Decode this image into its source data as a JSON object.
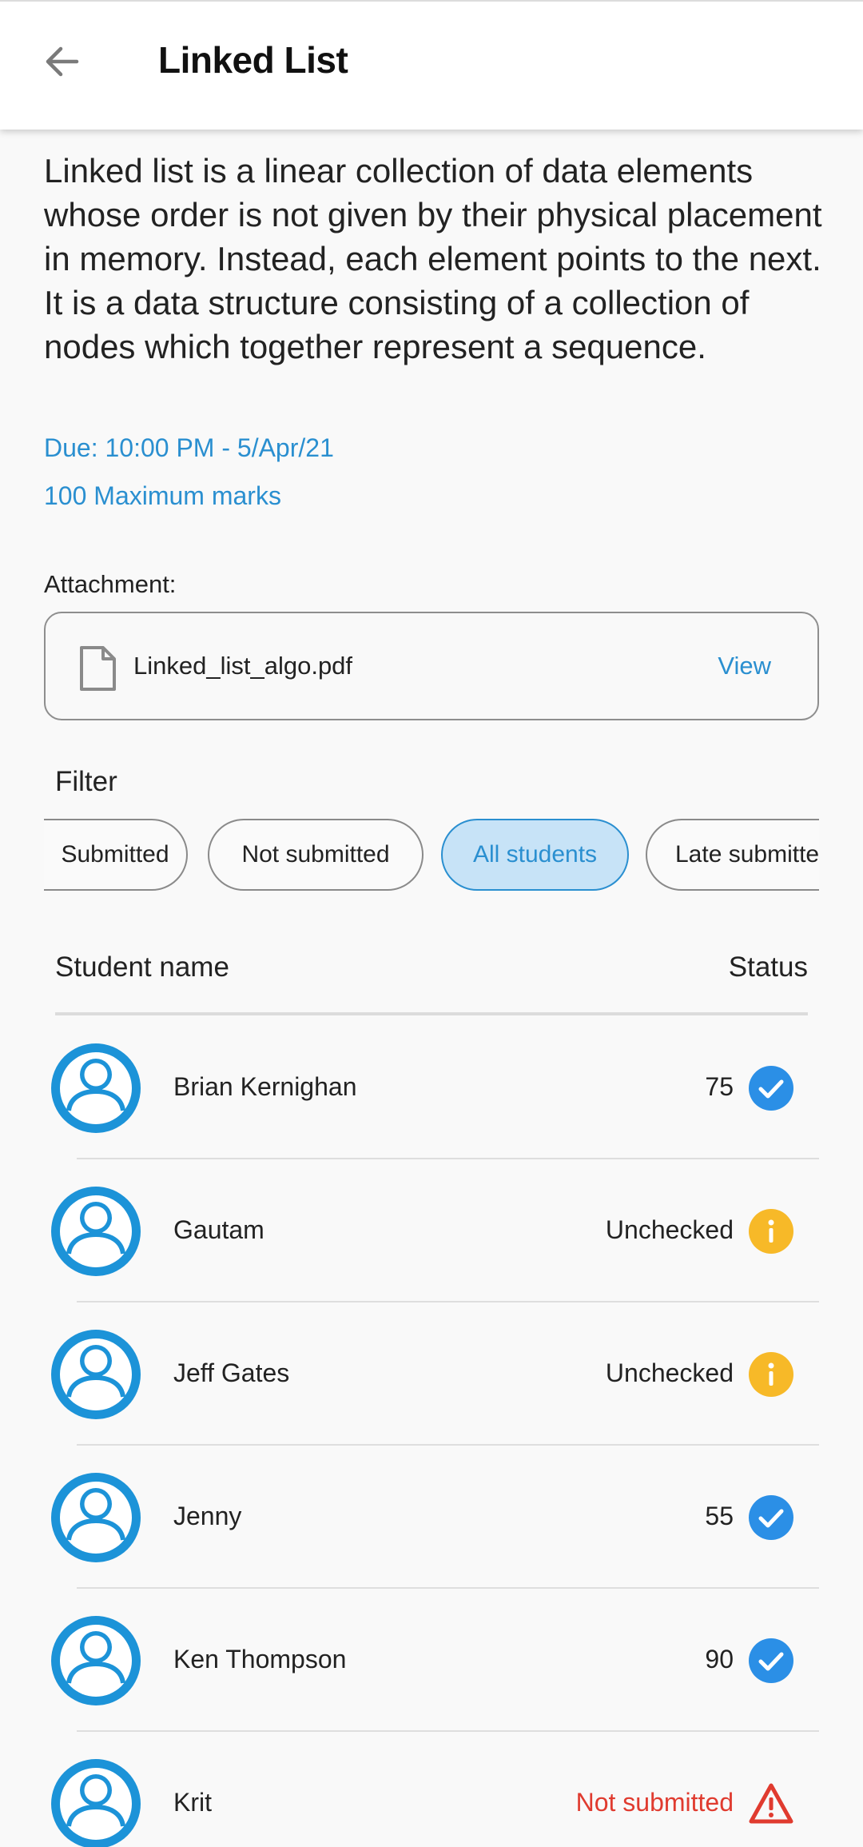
{
  "header": {
    "title": "Linked List",
    "back_icon": "arrow-left-icon"
  },
  "assignment": {
    "description": "Linked list is a linear collection of data elements whose order is not given by their physical placement in memory. Instead, each element points to the next. It is a data structure consisting of a collection of nodes which together represent a sequence.",
    "due": "Due: 10:00 PM - 5/Apr/21",
    "max_marks": "100 Maximum marks"
  },
  "attachment": {
    "label": "Attachment:",
    "file_name": "Linked_list_algo.pdf",
    "view_label": "View",
    "icon": "file-icon"
  },
  "filter": {
    "label": "Filter",
    "chips": [
      {
        "label": "Submitted",
        "selected": false
      },
      {
        "label": "Not submitted",
        "selected": false
      },
      {
        "label": "All students",
        "selected": true
      },
      {
        "label": "Late submitted",
        "selected": false
      }
    ]
  },
  "list": {
    "col_name": "Student name",
    "col_status": "Status",
    "students": [
      {
        "name": "Brian Kernighan",
        "status": "75",
        "status_type": "checked"
      },
      {
        "name": "Gautam",
        "status": "Unchecked",
        "status_type": "unchecked"
      },
      {
        "name": "Jeff Gates",
        "status": "Unchecked",
        "status_type": "unchecked"
      },
      {
        "name": "Jenny",
        "status": "55",
        "status_type": "checked"
      },
      {
        "name": "Ken Thompson",
        "status": "90",
        "status_type": "checked"
      },
      {
        "name": "Krit",
        "status": "Not submitted",
        "status_type": "not-submitted"
      }
    ]
  },
  "colors": {
    "accent": "#2a8fd0",
    "check": "#2b8fe6",
    "warning": "#f7b928",
    "error": "#e03b2f",
    "chip_selected_bg": "#c7e3f7"
  }
}
